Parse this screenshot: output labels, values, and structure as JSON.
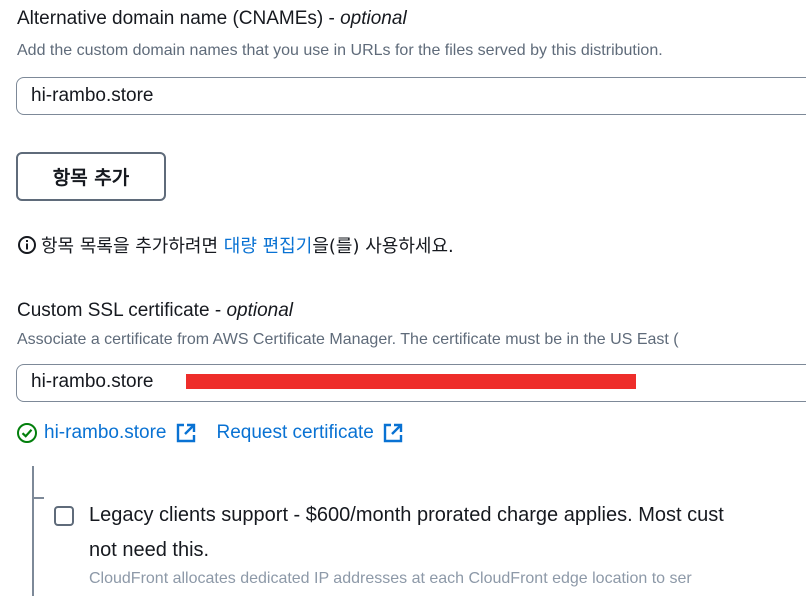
{
  "cname": {
    "label": "Alternative domain name (CNAMEs)",
    "optional": "optional",
    "description": "Add the custom domain names that you use in URLs for the files served by this distribution.",
    "value": "hi-rambo.store",
    "add_item_label": "항목 추가",
    "bulk_info_prefix": "항목 목록을 추가하려면",
    "bulk_link": "대량 편집기",
    "bulk_info_suffix": "을(를) 사용하세요."
  },
  "ssl": {
    "label": "Custom SSL certificate",
    "optional": "optional",
    "description": "Associate a certificate from AWS Certificate Manager. The certificate must be in the US East (",
    "value": "hi-rambo.store",
    "cert_link": "hi-rambo.store",
    "request_link": "Request certificate",
    "status_color": "#037f0c"
  },
  "legacy": {
    "label_line1": "Legacy clients support - $600/month prorated charge applies. Most cust",
    "label_line2": "not need this.",
    "description": "CloudFront allocates dedicated IP addresses at each CloudFront edge location to ser",
    "checked": false
  },
  "colors": {
    "link": "#0972d3",
    "text": "#16191f",
    "muted": "#5f6b7a",
    "redaction": "#ee2d2a"
  }
}
